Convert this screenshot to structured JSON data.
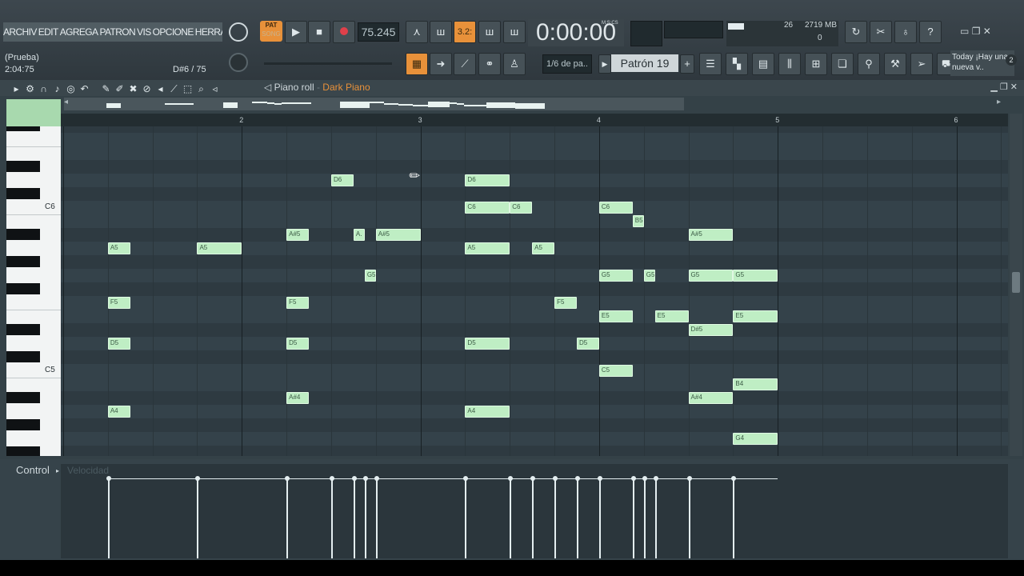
{
  "menu": [
    "ARCHIV",
    "EDIT",
    "AGREGA",
    "PATRON",
    "VIS",
    "OPCIONE",
    "HERRAMIENTA"
  ],
  "hint": {
    "line1": "(Prueba)",
    "line2": "2:04:75",
    "line3": "D#6 / 75"
  },
  "transport": {
    "pat_label": "PAT",
    "song_label": "SONG",
    "tempo": "75.245",
    "step": "3.2:"
  },
  "time": {
    "value": "0:00:00",
    "unit": "M:S:CS"
  },
  "monitor": {
    "cpu": "26",
    "memory": "2719 MB",
    "polyphony": "0"
  },
  "snap": "1/6 de pa..",
  "pattern": "Patrón 19",
  "news": {
    "title": "Today",
    "text": "¡Hay una nueva v..",
    "count": "2"
  },
  "pianoroll": {
    "title": "Piano roll",
    "instrument": "Dark Piano"
  },
  "ruler": [
    "2",
    "3",
    "4",
    "5",
    "6"
  ],
  "keys": [
    "C6",
    "C5"
  ],
  "notes": [
    {
      "label": "D6",
      "start": 1.5,
      "len": 0.125,
      "pitch": "D6"
    },
    {
      "label": "D6",
      "start": 2.25,
      "len": 0.25,
      "pitch": "D6"
    },
    {
      "label": "C6",
      "start": 2.25,
      "len": 0.25,
      "pitch": "C6"
    },
    {
      "label": "C6",
      "start": 2.5,
      "len": 0.125,
      "pitch": "C6"
    },
    {
      "label": "C6",
      "start": 3.0,
      "len": 0.1875,
      "pitch": "C6"
    },
    {
      "label": "B5",
      "start": 3.1875,
      "len": 0.0625,
      "pitch": "B5"
    },
    {
      "label": "A#5",
      "start": 1.25,
      "len": 0.125,
      "pitch": "A#5"
    },
    {
      "label": "A.",
      "start": 1.625,
      "len": 0.0625,
      "pitch": "A#5"
    },
    {
      "label": "A#5",
      "start": 1.75,
      "len": 0.25,
      "pitch": "A#5"
    },
    {
      "label": "A#5",
      "start": 3.5,
      "len": 0.25,
      "pitch": "A#5"
    },
    {
      "label": "A5",
      "start": 0.25,
      "len": 0.125,
      "pitch": "A5"
    },
    {
      "label": "A5",
      "start": 0.75,
      "len": 0.25,
      "pitch": "A5"
    },
    {
      "label": "A5",
      "start": 2.25,
      "len": 0.25,
      "pitch": "A5"
    },
    {
      "label": "A5",
      "start": 2.625,
      "len": 0.125,
      "pitch": "A5"
    },
    {
      "label": "G5",
      "start": 1.6875,
      "len": 0.0625,
      "pitch": "G5"
    },
    {
      "label": "G5",
      "start": 3.0,
      "len": 0.1875,
      "pitch": "G5"
    },
    {
      "label": "G5",
      "start": 3.25,
      "len": 0.0625,
      "pitch": "G5"
    },
    {
      "label": "G5",
      "start": 3.5,
      "len": 0.25,
      "pitch": "G5"
    },
    {
      "label": "G5",
      "start": 3.75,
      "len": 0.25,
      "pitch": "G5"
    },
    {
      "label": "F5",
      "start": 0.25,
      "len": 0.125,
      "pitch": "F5"
    },
    {
      "label": "F5",
      "start": 1.25,
      "len": 0.125,
      "pitch": "F5"
    },
    {
      "label": "F5",
      "start": 2.75,
      "len": 0.125,
      "pitch": "F5"
    },
    {
      "label": "E5",
      "start": 3.0,
      "len": 0.1875,
      "pitch": "E5"
    },
    {
      "label": "E5",
      "start": 3.3125,
      "len": 0.1875,
      "pitch": "E5"
    },
    {
      "label": "E5",
      "start": 3.75,
      "len": 0.25,
      "pitch": "E5"
    },
    {
      "label": "D#5",
      "start": 3.5,
      "len": 0.25,
      "pitch": "D#5"
    },
    {
      "label": "D5",
      "start": 0.25,
      "len": 0.125,
      "pitch": "D5"
    },
    {
      "label": "D5",
      "start": 1.25,
      "len": 0.125,
      "pitch": "D5"
    },
    {
      "label": "D5",
      "start": 2.25,
      "len": 0.25,
      "pitch": "D5"
    },
    {
      "label": "D5",
      "start": 2.875,
      "len": 0.125,
      "pitch": "D5"
    },
    {
      "label": "C5",
      "start": 3.0,
      "len": 0.1875,
      "pitch": "C5"
    },
    {
      "label": "B4",
      "start": 3.75,
      "len": 0.25,
      "pitch": "B4"
    },
    {
      "label": "A#4",
      "start": 1.25,
      "len": 0.125,
      "pitch": "A#4"
    },
    {
      "label": "A#4",
      "start": 3.5,
      "len": 0.25,
      "pitch": "A#4"
    },
    {
      "label": "A4",
      "start": 0.25,
      "len": 0.125,
      "pitch": "A4"
    },
    {
      "label": "A4",
      "start": 2.25,
      "len": 0.25,
      "pitch": "A4"
    },
    {
      "label": "G4",
      "start": 3.75,
      "len": 0.25,
      "pitch": "G4"
    }
  ],
  "control": {
    "label": "Control",
    "param": "Velocidad"
  },
  "colors": {
    "note": "#bfeec4",
    "accent": "#e8913a",
    "record": "#e0404a"
  }
}
